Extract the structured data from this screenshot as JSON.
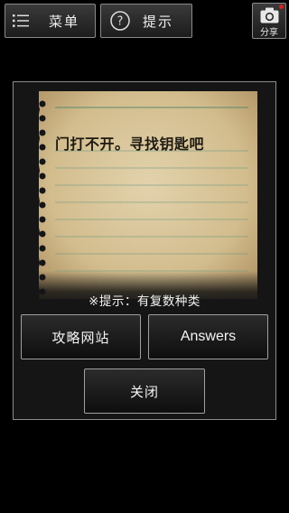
{
  "toolbar": {
    "menu_label": "菜单",
    "menu_icon": "list-icon",
    "hint_label": "提示",
    "hint_icon": "question-circle-icon",
    "share_label": "分享",
    "share_icon": "camera-icon"
  },
  "dialog": {
    "note_text": "门打不开。寻找钥匙吧",
    "hint_text": "※提示：有复数种类",
    "buttons": {
      "guide": "攻略网站",
      "answers": "Answers",
      "close": "关闭"
    }
  },
  "colors": {
    "background": "#000000",
    "paper": "#d8c49a",
    "button_border": "#a0a0a0",
    "badge": "#e02020"
  }
}
